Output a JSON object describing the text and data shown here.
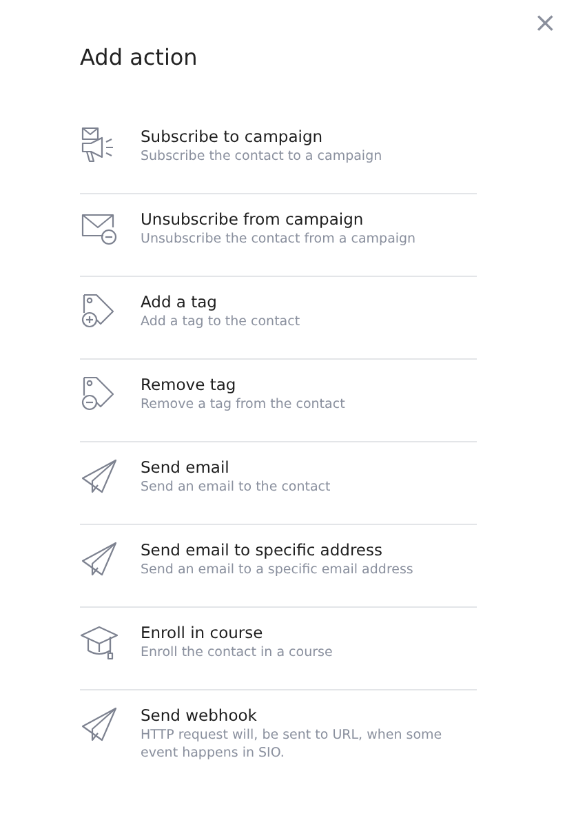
{
  "close_button": {
    "label": "×"
  },
  "title": "Add action",
  "actions": [
    {
      "kind": "megaphone",
      "title": "Subscribe to campaign",
      "description": "Subscribe the contact to a campaign"
    },
    {
      "kind": "unsubscribe",
      "title": "Unsubscribe from campaign",
      "description": "Unsubscribe the contact from a campaign"
    },
    {
      "kind": "addtag",
      "title": "Add a tag",
      "description": "Add a tag to the contact"
    },
    {
      "kind": "removetag",
      "title": "Remove tag",
      "description": "Remove a tag from the contact"
    },
    {
      "kind": "send",
      "title": "Send email",
      "description": "Send an email to the contact"
    },
    {
      "kind": "send",
      "title": "Send email to specific address",
      "description": "Send an email to a specific email address"
    },
    {
      "kind": "course",
      "title": "Enroll in course",
      "description": "Enroll the contact in a course"
    },
    {
      "kind": "send",
      "title": "Send webhook",
      "description": "HTTP request will, be sent to URL, when some event happens in SIO."
    }
  ]
}
